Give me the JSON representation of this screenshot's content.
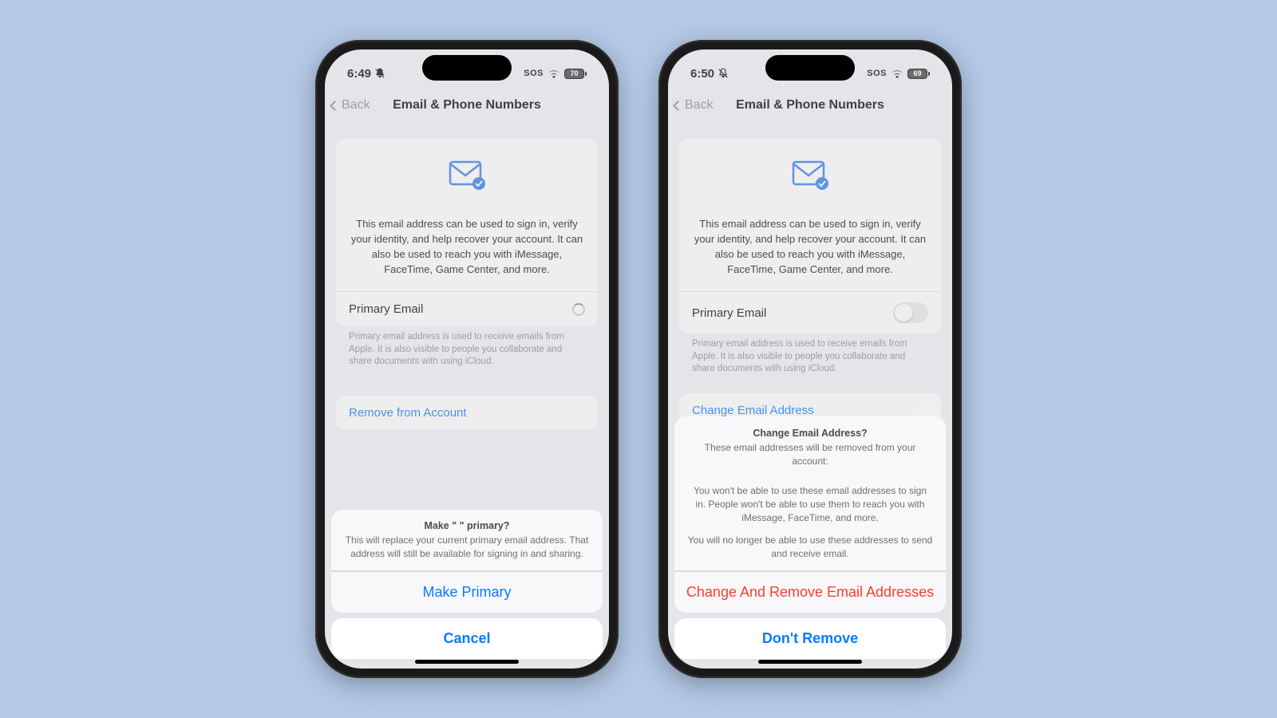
{
  "phones": [
    {
      "status": {
        "time": "6:49",
        "sos": "SOS",
        "battery": "70"
      },
      "nav": {
        "back": "Back",
        "title": "Email & Phone Numbers"
      },
      "desc": "This email address can be used to sign in, verify your identity, and help recover your account. It can also be used to reach you with iMessage, FaceTime, Game Center, and more.",
      "primary_label": "Primary Email",
      "primary_state": "loading",
      "footnote": "Primary email address is used to receive emails from Apple. It is also visible to people you collaborate and share documents with using iCloud.",
      "link": "Remove from Account",
      "sheet": {
        "title": "Make \"                                       \" primary?",
        "msg": "This will replace your current primary email address. That address will still be available for signing in and sharing.",
        "action": "Make Primary",
        "cancel": "Cancel"
      }
    },
    {
      "status": {
        "time": "6:50",
        "sos": "SOS",
        "battery": "69"
      },
      "nav": {
        "back": "Back",
        "title": "Email & Phone Numbers"
      },
      "desc": "This email address can be used to sign in, verify your identity, and help recover your account. It can also be used to reach you with iMessage, FaceTime, Game Center, and more.",
      "primary_label": "Primary Email",
      "primary_state": "switch_off",
      "footnote": "Primary email address is used to receive emails from Apple. It is also visible to people you collaborate and share documents with using iCloud.",
      "link": "Change Email Address",
      "alert": {
        "title": "Change Email Address?",
        "msg1": "These email addresses will be removed from your account:",
        "msg2": "You won't be able to use these email addresses to sign in. People won't be able to use them to reach you with iMessage, FaceTime, and more.",
        "msg3": "You will no longer be able to use these addresses to send and receive email.",
        "action": "Change And Remove Email Addresses",
        "cancel": "Don't Remove"
      }
    }
  ]
}
